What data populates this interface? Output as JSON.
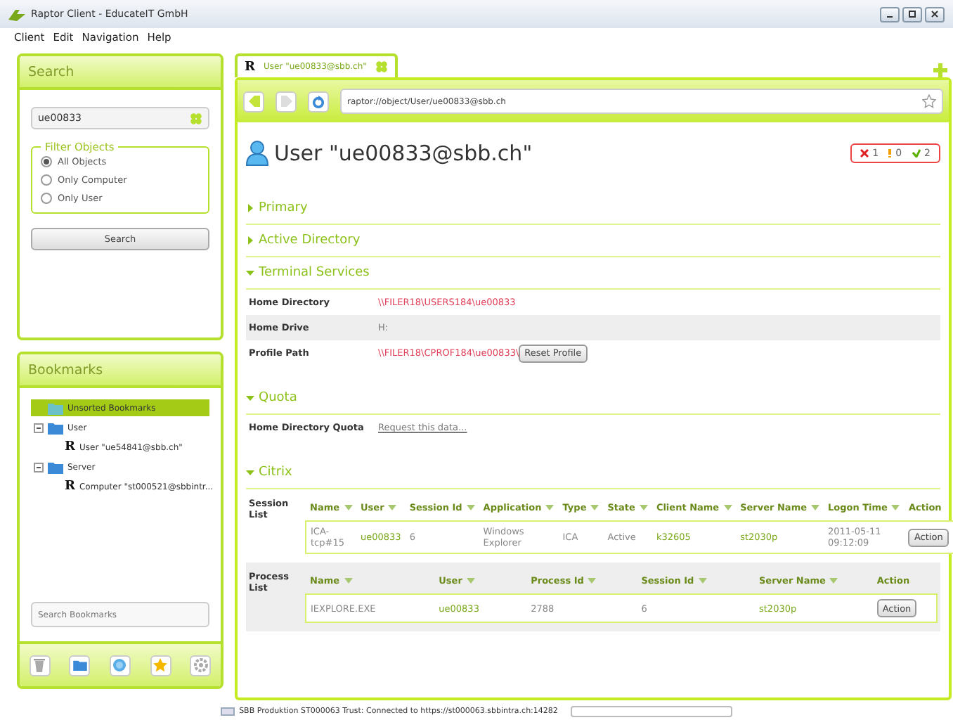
{
  "window": {
    "title": "Raptor Client - EducateIT GmbH"
  },
  "menu": [
    "Client",
    "Edit",
    "Navigation",
    "Help"
  ],
  "search": {
    "title": "Search",
    "value": "ue00833",
    "filter_title": "Filter Objects",
    "filters": [
      {
        "label": "All Objects",
        "selected": true
      },
      {
        "label": "Only Computer",
        "selected": false
      },
      {
        "label": "Only User",
        "selected": false
      }
    ],
    "button": "Search"
  },
  "bookmarks": {
    "title": "Bookmarks",
    "tree": [
      {
        "label": "Unsorted Bookmarks",
        "kind": "folder",
        "selected": true
      },
      {
        "label": "User",
        "kind": "folder",
        "selected": false,
        "expanded": true,
        "children": [
          {
            "label": "User \"ue54841@sbb.ch\"",
            "kind": "object",
            "icon": "R",
            "selected": false
          }
        ]
      },
      {
        "label": "Server",
        "kind": "folder",
        "selected": false,
        "expanded": true,
        "children": [
          {
            "label": "Computer \"st000521@sbbintr...",
            "kind": "object",
            "icon": "R",
            "selected": false
          }
        ]
      }
    ],
    "search_placeholder": "Search Bookmarks"
  },
  "tab": {
    "icon": "R",
    "label": "User \"ue00833@sbb.ch\""
  },
  "address": "raptor://object/User/ue00833@sbb.ch",
  "heading": "User \"ue00833@sbb.ch\"",
  "counts": [
    {
      "kind": "error",
      "value": "1"
    },
    {
      "kind": "warning",
      "value": "0"
    },
    {
      "kind": "ok",
      "value": "2"
    }
  ],
  "sections": [
    {
      "title": "Primary",
      "expanded": false
    },
    {
      "title": "Active Directory",
      "expanded": false
    },
    {
      "title": "Terminal Services",
      "expanded": true,
      "rows": [
        {
          "label": "Home Directory",
          "value": "\\\\FILER18\\USERS184\\ue00833",
          "kind": "path"
        },
        {
          "label": "Home Drive",
          "value": "H:",
          "kind": "text"
        },
        {
          "label": "Profile Path",
          "value": "\\\\FILER18\\CPROF184\\ue00833\\",
          "kind": "path",
          "button": "Reset Profile"
        }
      ]
    },
    {
      "title": "Quota",
      "expanded": true,
      "rows": [
        {
          "label": "Home Directory Quota",
          "value": "Request this data...",
          "kind": "link"
        }
      ]
    },
    {
      "title": "Citrix",
      "expanded": true,
      "tables": [
        {
          "label": "Session List",
          "columns": [
            {
              "name": "Name",
              "sortable": true
            },
            {
              "name": "User",
              "sortable": true
            },
            {
              "name": "Session Id",
              "sortable": true
            },
            {
              "name": "Application",
              "sortable": true
            },
            {
              "name": "Type",
              "sortable": true
            },
            {
              "name": "State",
              "sortable": true
            },
            {
              "name": "Client Name",
              "sortable": true
            },
            {
              "name": "Server Name",
              "sortable": true
            },
            {
              "name": "Logon Time",
              "sortable": true
            },
            {
              "name": "Action",
              "sortable": false
            }
          ],
          "rows": [
            [
              {
                "text": "ICA-tcp#15",
                "kind": "text"
              },
              {
                "text": "ue00833",
                "kind": "link"
              },
              {
                "text": "6",
                "kind": "text"
              },
              {
                "text": "Windows Explorer",
                "kind": "text"
              },
              {
                "text": "ICA",
                "kind": "text"
              },
              {
                "text": "Active",
                "kind": "text"
              },
              {
                "text": "k32605",
                "kind": "link"
              },
              {
                "text": "st2030p",
                "kind": "link"
              },
              {
                "text": "2011-05-11 09:12:09",
                "kind": "text"
              },
              {
                "text": "Action",
                "kind": "button"
              }
            ]
          ]
        },
        {
          "label": "Process List",
          "columns": [
            {
              "name": "Name",
              "sortable": true
            },
            {
              "name": "User",
              "sortable": true
            },
            {
              "name": "Process Id",
              "sortable": true
            },
            {
              "name": "Session Id",
              "sortable": true
            },
            {
              "name": "Server Name",
              "sortable": true
            },
            {
              "name": "Action",
              "sortable": false
            }
          ],
          "rows": [
            [
              {
                "text": "IEXPLORE.EXE",
                "kind": "text"
              },
              {
                "text": "ue00833",
                "kind": "link"
              },
              {
                "text": "2788",
                "kind": "text"
              },
              {
                "text": "6",
                "kind": "text"
              },
              {
                "text": "st2030p",
                "kind": "link"
              },
              {
                "text": "Action",
                "kind": "button"
              }
            ]
          ]
        }
      ]
    }
  ],
  "status": "SBB Produktion ST000063 Trust: Connected to https://st000063.sbbintra.ch:14282"
}
